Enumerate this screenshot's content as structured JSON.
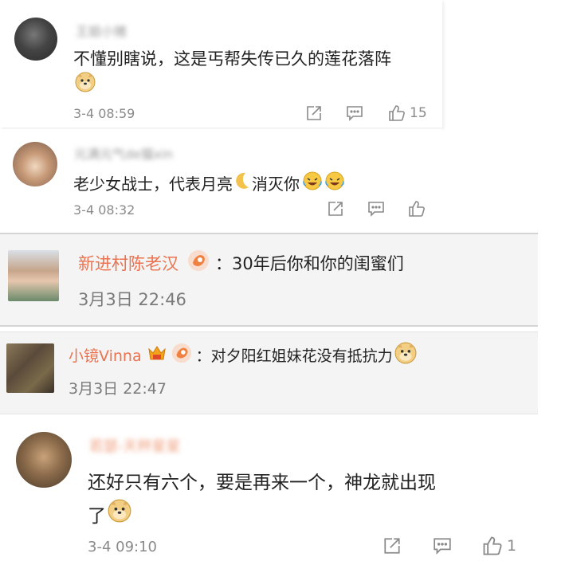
{
  "comments": [
    {
      "username": "王姐小猪",
      "text": "不懂别瞎说，这是丐帮失传已久的莲花落阵",
      "time": "3-4 08:59",
      "likes": "15",
      "emoji": "doge-icon"
    },
    {
      "username": "元满元气de猫xin",
      "text_before": "老少女战士，代表月亮",
      "text_after": "消灭你",
      "time": "3-4 08:32",
      "emoji": "laugh-cry-icon"
    },
    {
      "username": "新进村陈老汉",
      "text": "：30年后你和你的闺蜜们",
      "time": "3月3日 22:46"
    },
    {
      "username": "小镜Vinna",
      "text": "：对夕阳红姐妹花没有抵抗力",
      "time": "3月3日 22:47"
    },
    {
      "username": "若瑟-天秤星星",
      "text_line1": "还好只有六个，要是再来一个，神龙就出现",
      "text_line2": "了",
      "time": "3-4 09:10",
      "likes": "1"
    }
  ],
  "colors": {
    "weibo_name": "#eb7350",
    "link_name": "#e8553a",
    "gray": "#8a8a8a"
  }
}
